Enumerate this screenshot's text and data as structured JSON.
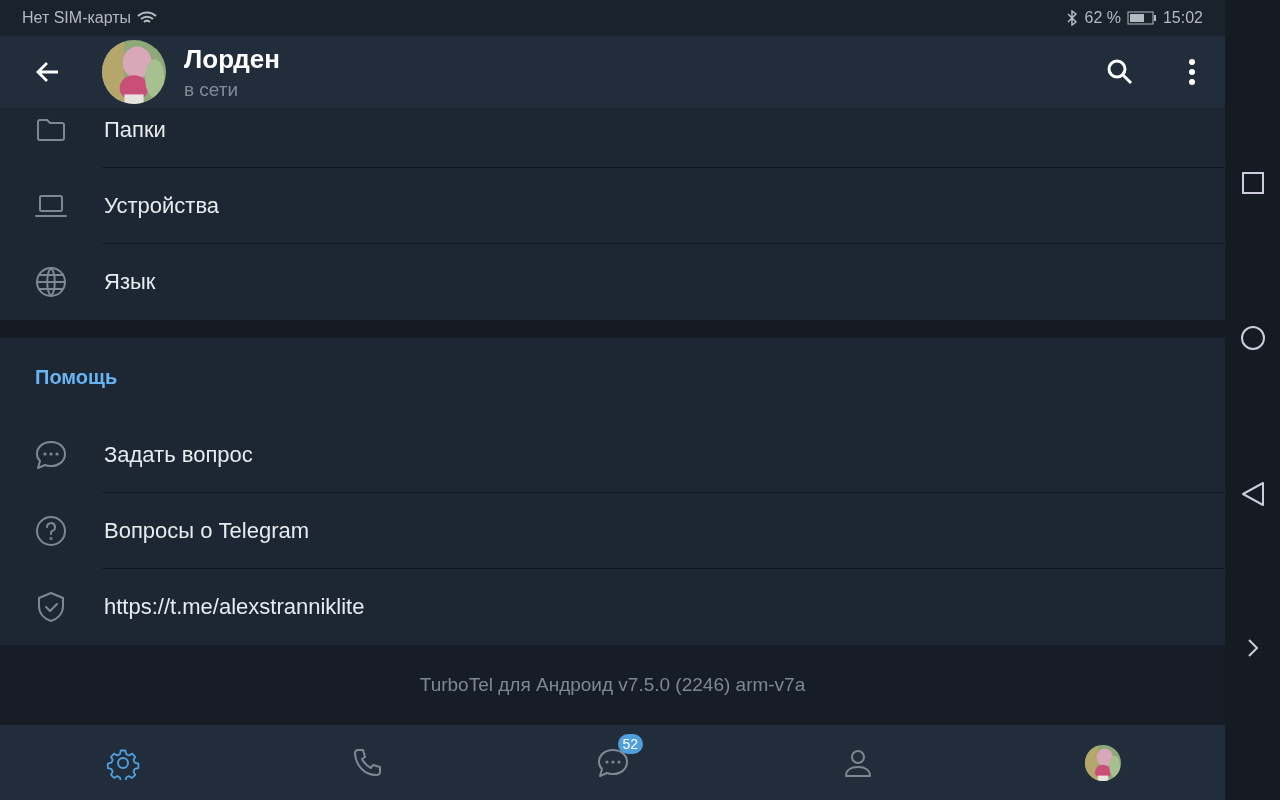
{
  "status_bar": {
    "carrier": "Нет SIM-карты",
    "battery": "62 %",
    "time": "15:02"
  },
  "header": {
    "title": "Лорден",
    "subtitle": "в сети"
  },
  "sections": [
    {
      "items": [
        {
          "kind": "folder",
          "label": "Папки"
        },
        {
          "kind": "laptop",
          "label": "Устройства"
        },
        {
          "kind": "globe",
          "label": "Язык"
        }
      ]
    },
    {
      "title": "Помощь",
      "items": [
        {
          "kind": "chat",
          "label": "Задать вопрос"
        },
        {
          "kind": "question",
          "label": "Вопросы о Telegram"
        },
        {
          "kind": "shield",
          "label": "https://t.me/alexstranniklite"
        }
      ]
    }
  ],
  "footer": "TurboTel для Андроид v7.5.0 (2246) arm-v7a",
  "tabs": [
    {
      "kind": "settings",
      "selected": true
    },
    {
      "kind": "phone",
      "selected": false
    },
    {
      "kind": "chat",
      "selected": false,
      "badge": "52"
    },
    {
      "kind": "person",
      "selected": false
    },
    {
      "kind": "avatar",
      "selected": false
    }
  ]
}
